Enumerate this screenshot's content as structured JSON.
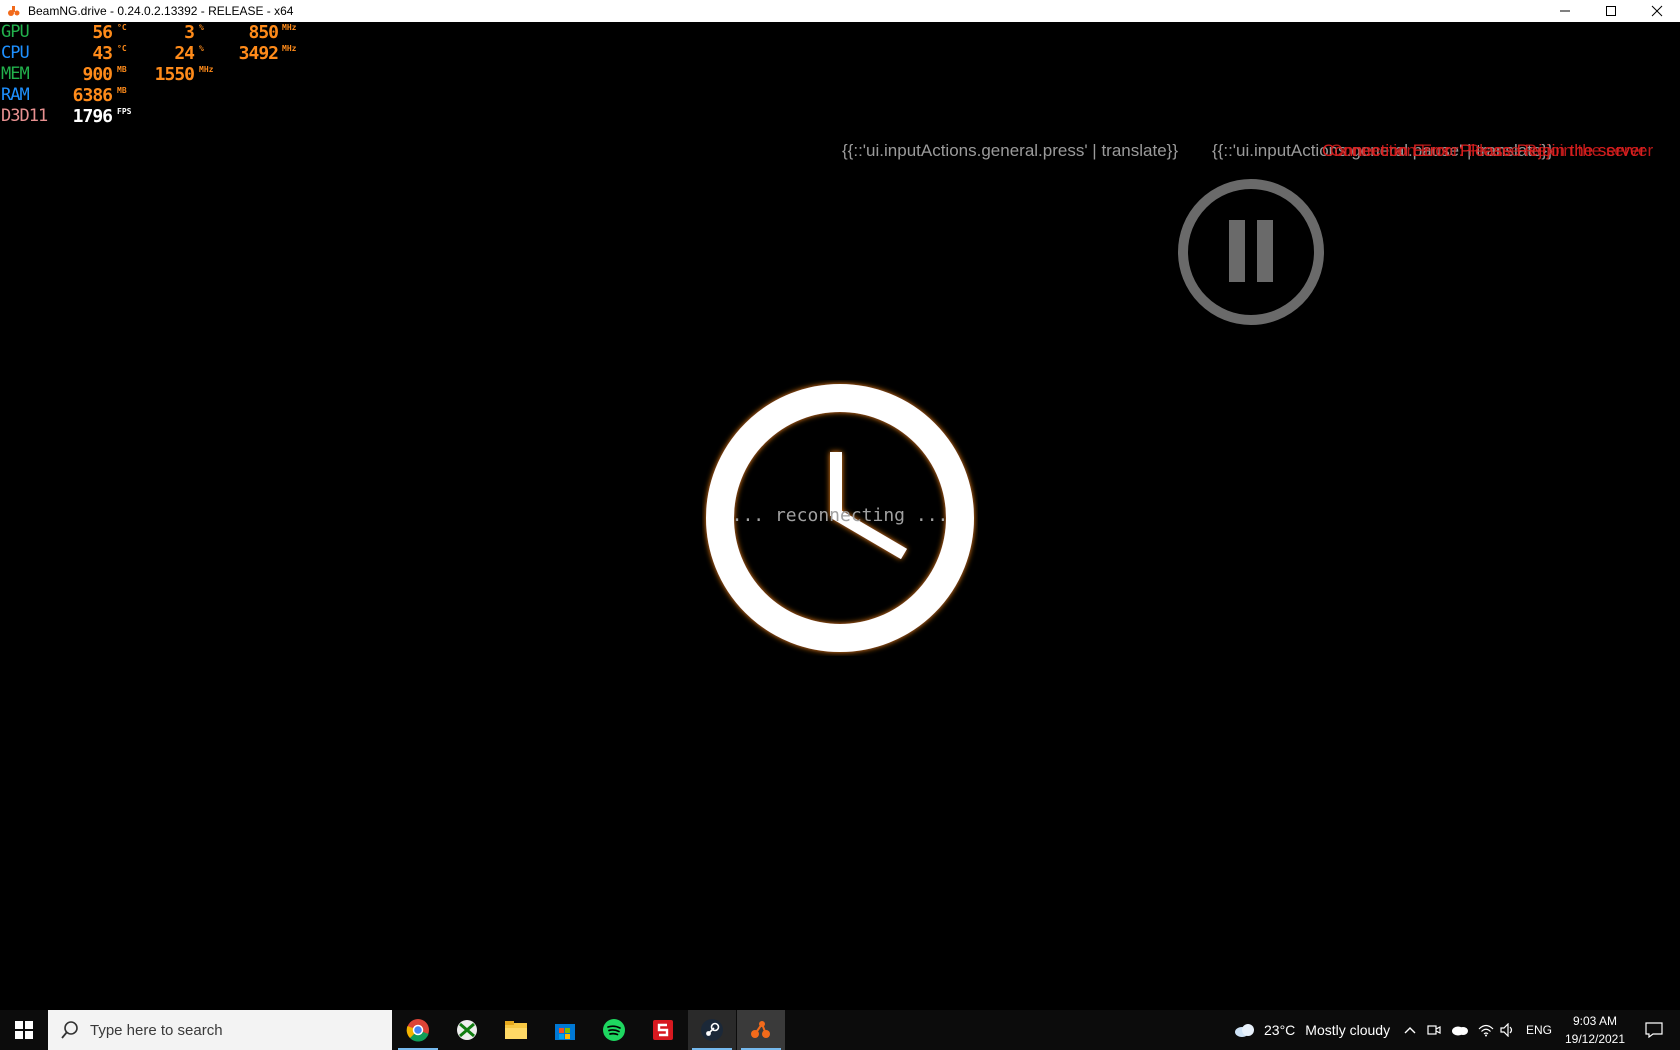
{
  "window": {
    "title": "BeamNG.drive - 0.24.0.2.13392 - RELEASE - x64"
  },
  "perf": {
    "gpu": {
      "label": "GPU",
      "temp": "56",
      "temp_unit": "°C",
      "load": "3",
      "load_unit": "%",
      "clock": "850",
      "clock_unit": "MHz",
      "label_color": "#22b14c"
    },
    "cpu": {
      "label": "CPU",
      "temp": "43",
      "temp_unit": "°C",
      "load": "24",
      "load_unit": "%",
      "clock": "3492",
      "clock_unit": "MHz",
      "label_color": "#1e90ff"
    },
    "mem": {
      "label": "MEM",
      "used": "900",
      "used_unit": "MB",
      "clock": "1550",
      "clock_unit": "MHz",
      "label_color": "#22b14c"
    },
    "ram": {
      "label": "RAM",
      "used": "6386",
      "used_unit": "MB",
      "label_color": "#1e90ff"
    },
    "api": {
      "label": "D3D11",
      "fps": "1796",
      "fps_unit": "FPS",
      "label_color": "#e89090"
    }
  },
  "hints": {
    "press": "{{::'ui.inputActions.general.press' | translate}}",
    "action": "{{::'ui.inputActions.general.pause' | translate}}",
    "error": "Connection Error: Please Rejoin the server",
    "error_overlap": "Connection Error: Please Rejoin the server"
  },
  "center": {
    "status": "... reconnecting ..."
  },
  "taskbar": {
    "search_placeholder": "Type here to search",
    "apps": [
      "chrome-icon",
      "xbox-icon",
      "file-explorer-icon",
      "store-icon",
      "spotify-icon",
      "app-red-icon",
      "steam-icon",
      "beamng-icon"
    ],
    "weather": {
      "temp": "23°C",
      "condition": "Mostly cloudy"
    },
    "language": "ENG",
    "time": "9:03 AM",
    "date": "19/12/2021"
  },
  "colors": {
    "accent_orange": "#ff8b1a",
    "error_red": "#d81e1e",
    "hint_gray": "#9a9a9a"
  }
}
